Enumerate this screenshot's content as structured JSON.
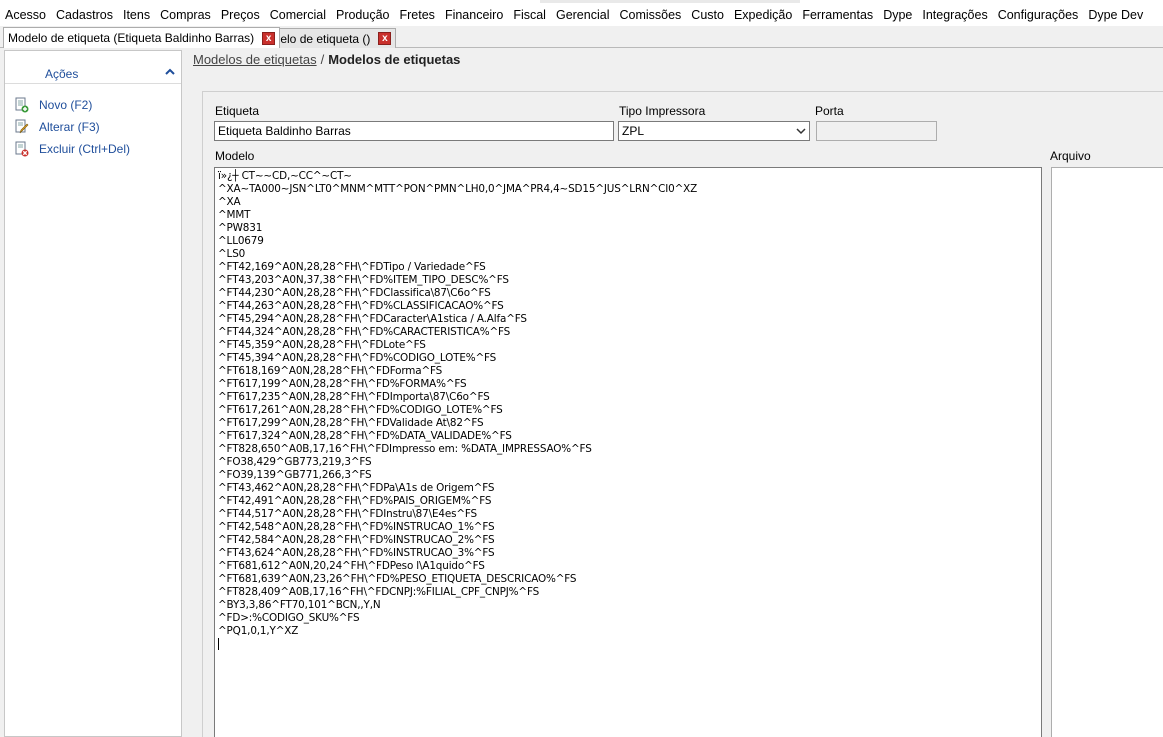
{
  "menu": [
    "Acesso",
    "Cadastros",
    "Itens",
    "Compras",
    "Preços",
    "Comercial",
    "Produção",
    "Fretes",
    "Financeiro",
    "Fiscal",
    "Gerencial",
    "Comissões",
    "Custo",
    "Expedição",
    "Ferramentas",
    "Dype",
    "Integrações",
    "Configurações",
    "Dype Dev"
  ],
  "tabs": [
    {
      "label": "Modelo de etiqueta (Etiqueta Baldinho Barras)",
      "active": true
    },
    {
      "label": "Modelo de etiqueta ()",
      "active": false
    }
  ],
  "tab_close_glyph": "x",
  "sidebar": {
    "title": "Ações",
    "actions": [
      {
        "label": "Novo (F2)",
        "icon": "new-document-icon"
      },
      {
        "label": "Alterar (F3)",
        "icon": "edit-document-icon"
      },
      {
        "label": "Excluir (Ctrl+Del)",
        "icon": "delete-document-icon"
      }
    ]
  },
  "breadcrumb": {
    "link": "Modelos de etiquetas",
    "separator": "/",
    "current": "Modelos de etiquetas"
  },
  "form": {
    "etiqueta_label": "Etiqueta",
    "etiqueta_value": "Etiqueta Baldinho Barras",
    "tipo_label": "Tipo Impressora",
    "tipo_value": "ZPL",
    "porta_label": "Porta",
    "porta_value": "",
    "modelo_label": "Modelo",
    "arquivo_label": "Arquivo"
  },
  "modelo_lines": [
    "ï»¿┼ CT~~CD,~CC^~CT~",
    "^XA~TA000~JSN^LT0^MNM^MTT^PON^PMN^LH0,0^JMA^PR4,4~SD15^JUS^LRN^CI0^XZ",
    "^XA",
    "^MMT",
    "^PW831",
    "^LL0679",
    "^LS0",
    "^FT42,169^A0N,28,28^FH\\^FDTipo / Variedade^FS",
    "^FT43,203^A0N,37,38^FH\\^FD%ITEM_TIPO_DESC%^FS",
    "^FT44,230^A0N,28,28^FH\\^FDClassifica\\87\\C6o^FS",
    "^FT44,263^A0N,28,28^FH\\^FD%CLASSIFICACAO%^FS",
    "^FT45,294^A0N,28,28^FH\\^FDCaracter\\A1stica / A.Alfa^FS",
    "^FT44,324^A0N,28,28^FH\\^FD%CARACTERISTICA%^FS",
    "^FT45,359^A0N,28,28^FH\\^FDLote^FS",
    "^FT45,394^A0N,28,28^FH\\^FD%CODIGO_LOTE%^FS",
    "^FT618,169^A0N,28,28^FH\\^FDForma^FS",
    "^FT617,199^A0N,28,28^FH\\^FD%FORMA%^FS",
    "^FT617,235^A0N,28,28^FH\\^FDImporta\\87\\C6o^FS",
    "^FT617,261^A0N,28,28^FH\\^FD%CODIGO_LOTE%^FS",
    "^FT617,299^A0N,28,28^FH\\^FDValidade At\\82^FS",
    "^FT617,324^A0N,28,28^FH\\^FD%DATA_VALIDADE%^FS",
    "^FT828,650^A0B,17,16^FH\\^FDImpresso em: %DATA_IMPRESSAO%^FS",
    "^FO38,429^GB773,219,3^FS",
    "^FO39,139^GB771,266,3^FS",
    "^FT43,462^A0N,28,28^FH\\^FDPa\\A1s de Origem^FS",
    "^FT42,491^A0N,28,28^FH\\^FD%PAIS_ORIGEM%^FS",
    "^FT44,517^A0N,28,28^FH\\^FDInstru\\87\\E4es^FS",
    "^FT42,548^A0N,28,28^FH\\^FD%INSTRUCAO_1%^FS",
    "^FT42,584^A0N,28,28^FH\\^FD%INSTRUCAO_2%^FS",
    "^FT43,624^A0N,28,28^FH\\^FD%INSTRUCAO_3%^FS",
    "^FT681,612^A0N,20,24^FH\\^FDPeso l\\A1quido^FS",
    "^FT681,639^A0N,23,26^FH\\^FD%PESO_ETIQUETA_DESCRICAO%^FS",
    "^FT828,409^A0B,17,16^FH\\^FDCNPJ:%FILIAL_CPF_CNPJ%^FS",
    "^BY3,3,86^FT70,101^BCN,,Y,N",
    "^FD>:%CODIGO_SKU%^FS",
    "^PQ1,0,1,Y^XZ"
  ]
}
